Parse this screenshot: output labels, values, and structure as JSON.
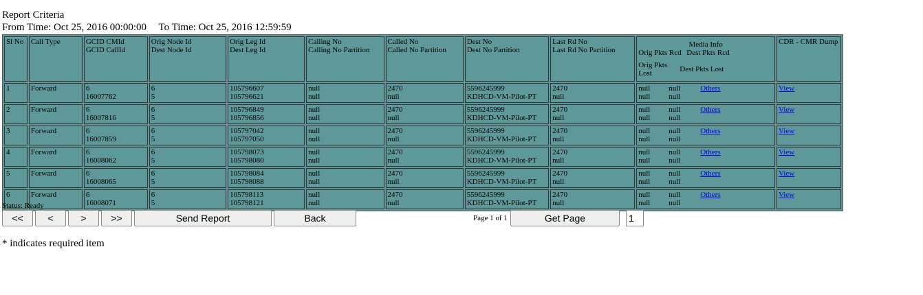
{
  "criteria": {
    "title": "Report Criteria",
    "from_label": "From Time:",
    "from_value": "Oct 25, 2016 00:00:00",
    "to_label": "To Time:",
    "to_value": "Oct 25, 2016 12:59:59"
  },
  "table": {
    "headers": {
      "sl_no": "Sl No",
      "call_type": "Call Type",
      "gcid_cmid": "GCID CMId",
      "gcid_callid": "GCID CallId",
      "orig_node": "Orig Node Id",
      "dest_node": "Dest Node Id",
      "orig_leg": "Orig Leg Id",
      "dest_leg": "Dest Leg Id",
      "calling_no": "Calling No",
      "calling_part": "Calling No Partition",
      "called_no": "Called No",
      "called_part": "Called No Partition",
      "dest_no": "Dest No",
      "dest_part": "Dest No Partition",
      "last_rd": "Last Rd No",
      "last_rd_part": "Last Rd No Partition",
      "media_info": "Media Info",
      "orig_pkts_rcd": "Orig Pkts Rcd",
      "dest_pkts_rcd": "Dest Pkts Rcd",
      "orig_pkts_lost": "Orig Pkts Lost",
      "dest_pkts_lost": "Dest Pkts Lost",
      "cdr_dump": "CDR - CMR Dump"
    },
    "rows": [
      {
        "sl": "1",
        "type": "Forward",
        "cmid": "6",
        "callid": "16007762",
        "onode": "6",
        "dnode": "5",
        "oleg": "105796607",
        "dleg": "105796621",
        "calling": "null",
        "calling_p": "null",
        "called": "2470",
        "called_p": "null",
        "dest": "5596245999",
        "dest_p": "KDHCD-VM-Pilot-PT",
        "lrd": "2470",
        "lrd_p": "null",
        "m1": "null",
        "m2": "null",
        "m3": "null",
        "m4": "null",
        "others": "Others",
        "view": "View"
      },
      {
        "sl": "2",
        "type": "Forward",
        "cmid": "6",
        "callid": "16007816",
        "onode": "6",
        "dnode": "5",
        "oleg": "105796849",
        "dleg": "105796856",
        "calling": "null",
        "calling_p": "null",
        "called": "2470",
        "called_p": "null",
        "dest": "5596245999",
        "dest_p": "KDHCD-VM-Pilot-PT",
        "lrd": "2470",
        "lrd_p": "null",
        "m1": "null",
        "m2": "null",
        "m3": "null",
        "m4": "null",
        "others": "Others",
        "view": "View"
      },
      {
        "sl": "3",
        "type": "Forward",
        "cmid": "6",
        "callid": "16007859",
        "onode": "6",
        "dnode": "5",
        "oleg": "105797042",
        "dleg": "105797050",
        "calling": "null",
        "calling_p": "null",
        "called": "2470",
        "called_p": "null",
        "dest": "5596245999",
        "dest_p": "KDHCD-VM-Pilot-PT",
        "lrd": "2470",
        "lrd_p": "null",
        "m1": "null",
        "m2": "null",
        "m3": "null",
        "m4": "null",
        "others": "Others",
        "view": "View"
      },
      {
        "sl": "4",
        "type": "Forward",
        "cmid": "6",
        "callid": "16008062",
        "onode": "6",
        "dnode": "5",
        "oleg": "105798073",
        "dleg": "105798080",
        "calling": "null",
        "calling_p": "null",
        "called": "2470",
        "called_p": "null",
        "dest": "5596245999",
        "dest_p": "KDHCD-VM-Pilot-PT",
        "lrd": "2470",
        "lrd_p": "null",
        "m1": "null",
        "m2": "null",
        "m3": "null",
        "m4": "null",
        "others": "Others",
        "view": "View"
      },
      {
        "sl": "5",
        "type": "Forward",
        "cmid": "6",
        "callid": "16008065",
        "onode": "6",
        "dnode": "5",
        "oleg": "105798084",
        "dleg": "105798088",
        "calling": "null",
        "calling_p": "null",
        "called": "2470",
        "called_p": "null",
        "dest": "5596245999",
        "dest_p": "KDHCD-VM-Pilot-PT",
        "lrd": "2470",
        "lrd_p": "null",
        "m1": "null",
        "m2": "null",
        "m3": "null",
        "m4": "null",
        "others": "Others",
        "view": "View"
      },
      {
        "sl": "6",
        "type": "Forward",
        "cmid": "6",
        "callid": "16008071",
        "onode": "6",
        "dnode": "5",
        "oleg": "105798113",
        "dleg": "105798121",
        "calling": "null",
        "calling_p": "null",
        "called": "2470",
        "called_p": "null",
        "dest": "5596245999",
        "dest_p": "KDHCD-VM-Pilot-PT",
        "lrd": "2470",
        "lrd_p": "null",
        "m1": "null",
        "m2": "null",
        "m3": "null",
        "m4": "null",
        "others": "Others",
        "view": "View"
      }
    ]
  },
  "status": "Status: Ready",
  "nav": {
    "first": "<<",
    "prev": "<",
    "next": ">",
    "last": ">>",
    "send_report": "Send Report",
    "back": "Back",
    "page_info": "Page 1 of 1",
    "get_page": "Get Page",
    "page_value": "1"
  },
  "footer": {
    "required_note": "* indicates required item"
  },
  "colors": {
    "table_bg": "#5f9898",
    "link": "#0000ee"
  }
}
